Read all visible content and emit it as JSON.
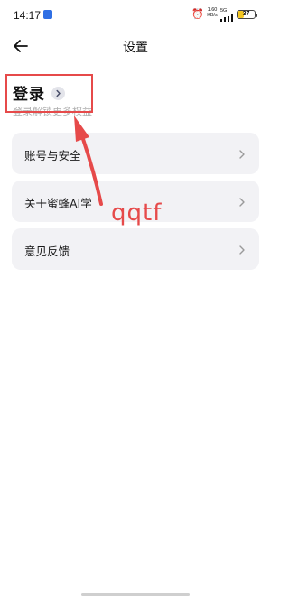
{
  "status_bar": {
    "time": "14:17",
    "net_speed_value": "1.60",
    "net_speed_unit": "KB/s",
    "network_type": "5G",
    "battery_level": "37"
  },
  "header": {
    "title": "设置"
  },
  "login": {
    "title": "登录",
    "subtitle": "登录解锁更多权益"
  },
  "menu": {
    "items": [
      {
        "label": "账号与安全"
      },
      {
        "label": "关于蜜蜂AI学"
      },
      {
        "label": "意见反馈"
      }
    ]
  },
  "annotation": {
    "text": "qqtf",
    "color": "#e64a4a"
  },
  "colors": {
    "card_bg": "#f2f2f5",
    "battery_fill": "#f3c623",
    "subtitle": "#b0b0b0"
  },
  "icons": [
    "back-arrow-icon",
    "chevron-right-icon",
    "alarm-icon",
    "signal-icon",
    "battery-icon"
  ]
}
